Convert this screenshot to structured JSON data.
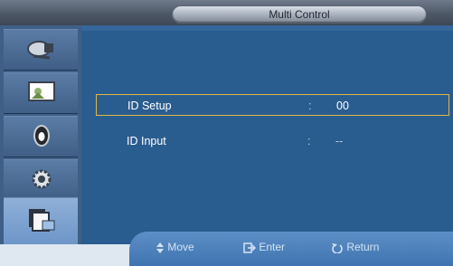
{
  "title": "Multi Control",
  "sidebar": {
    "items": [
      {
        "icon": "satellite-dish-icon"
      },
      {
        "icon": "picture-icon"
      },
      {
        "icon": "speaker-icon"
      },
      {
        "icon": "gear-icon"
      },
      {
        "icon": "multi-window-icon"
      }
    ]
  },
  "menu": {
    "items": [
      {
        "label": "ID Setup",
        "separator": ":",
        "value": "00"
      },
      {
        "label": "ID Input",
        "separator": ":",
        "value": "--"
      }
    ]
  },
  "help": {
    "move_label": "Move",
    "enter_label": "Enter",
    "return_label": "Return"
  },
  "colors": {
    "selection_border": "#e2b54a",
    "panel": "#2a5d8f"
  }
}
